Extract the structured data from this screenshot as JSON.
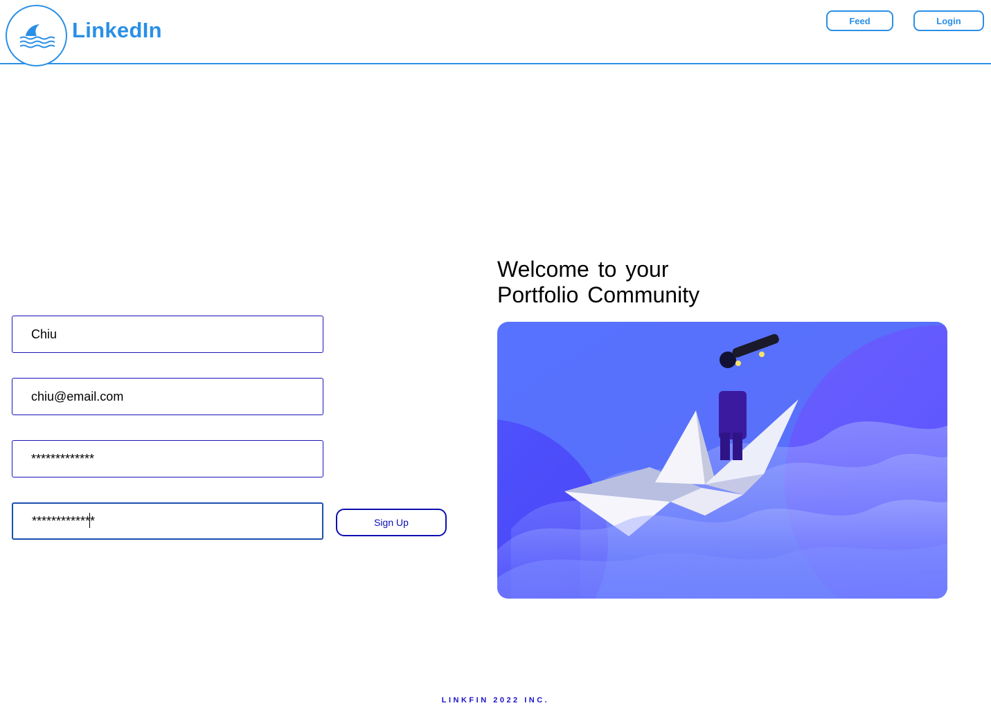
{
  "header": {
    "brand": "LinkedIn",
    "nav": {
      "feed_label": "Feed",
      "login_label": "Login"
    }
  },
  "form": {
    "name_value": "Chiu",
    "email_value": "chiu@email.com",
    "password_value": "*************",
    "confirm_password_value": "*************",
    "signup_label": "Sign Up"
  },
  "welcome": {
    "line1": "Welcome to your",
    "line2": "Portfolio Community"
  },
  "footer": {
    "text": "LINKFIN 2022 INC."
  },
  "colors": {
    "brand_blue": "#2a8fe6",
    "form_border": "#1a12b8",
    "button_text": "#0a0fb0",
    "hero_bg": "#5570ff"
  },
  "icons": {
    "logo": "shark-fin-waves-icon"
  }
}
